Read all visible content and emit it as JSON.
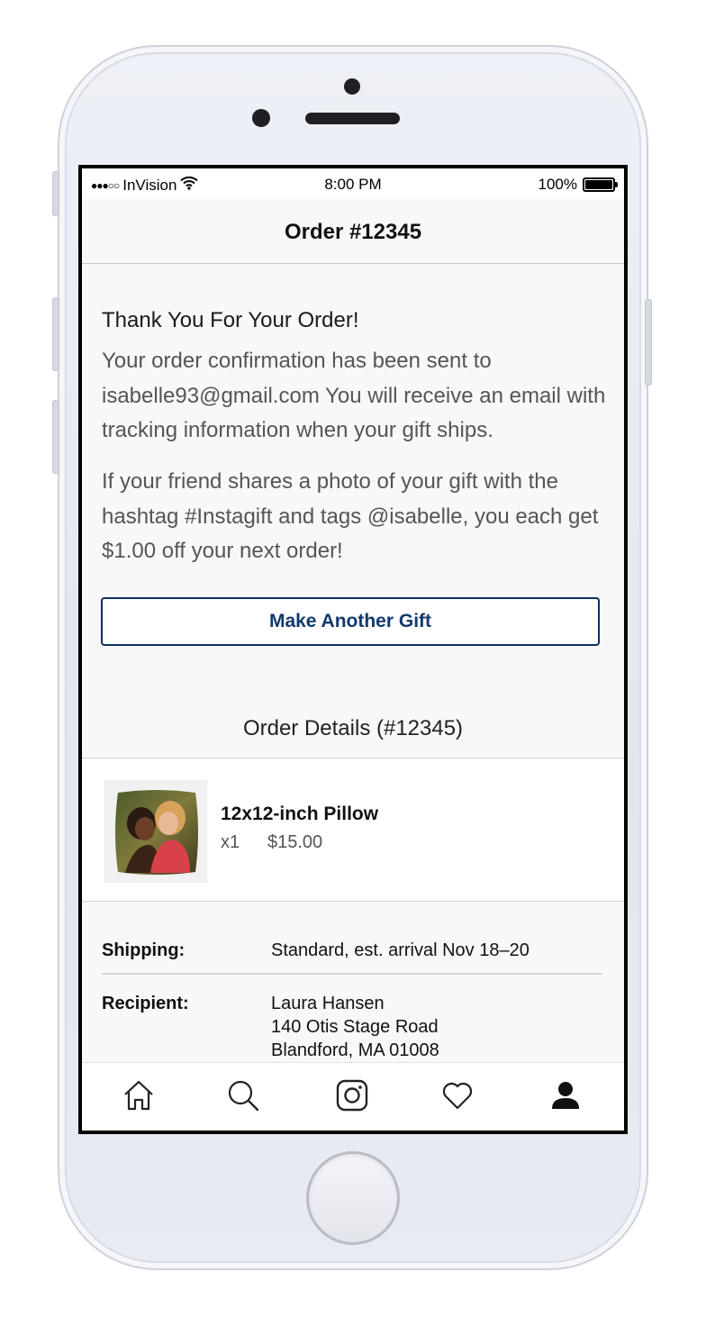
{
  "status_bar": {
    "carrier": "InVision",
    "signal_dots": "●●●○○",
    "time": "8:00 PM",
    "battery_percent": "100%"
  },
  "nav": {
    "title": "Order #12345"
  },
  "confirmation": {
    "heading": "Thank You For Your Order!",
    "message": "Your order confirmation has been sent to isabelle93@gmail.com You will receive an email with tracking information when your gift ships.",
    "promo": "If your friend shares a photo of your gift with the hashtag #Instagift and tags @isabelle, you each get $1.00 off your next order!",
    "button_label": "Make Another Gift"
  },
  "order_details": {
    "heading": "Order Details (#12345)",
    "item": {
      "name": "12x12-inch Pillow",
      "quantity": "x1",
      "price": "$15.00",
      "image_icon": "pillow-photo"
    },
    "shipping_label": "Shipping:",
    "shipping_value": "Standard, est. arrival Nov 18–20",
    "recipient_label": "Recipient:",
    "recipient_lines": [
      "Laura Hansen",
      "140 Otis Stage Road",
      "Blandford, MA 01008"
    ]
  },
  "tab_bar": {
    "items": [
      {
        "icon": "home-icon"
      },
      {
        "icon": "search-icon"
      },
      {
        "icon": "camera-icon"
      },
      {
        "icon": "heart-icon"
      },
      {
        "icon": "profile-icon",
        "active": true
      }
    ]
  },
  "colors": {
    "accent": "#123a6d",
    "screen_background": "#f8f8f8",
    "phone_body": "#e8eaf2"
  }
}
